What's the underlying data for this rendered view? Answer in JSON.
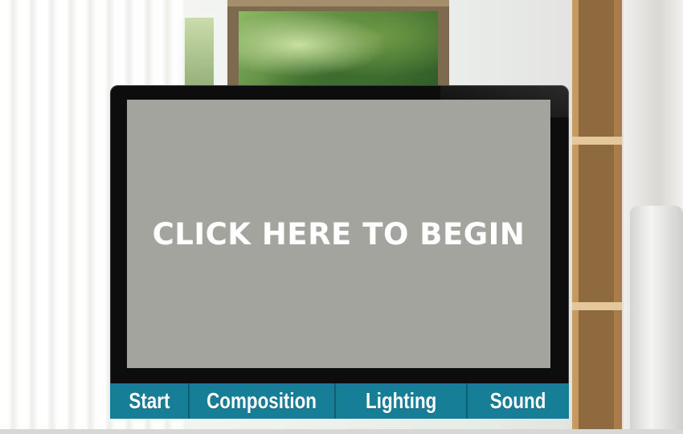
{
  "screen": {
    "begin_label": "CLICK HERE TO BEGIN"
  },
  "nav": {
    "items": [
      {
        "label": "Start"
      },
      {
        "label": "Composition"
      },
      {
        "label": "Lighting"
      },
      {
        "label": "Sound"
      }
    ]
  },
  "colors": {
    "nav_background": "#177e97",
    "screen_background": "#a4a49f",
    "monitor_bezel": "#0d0d0d"
  }
}
